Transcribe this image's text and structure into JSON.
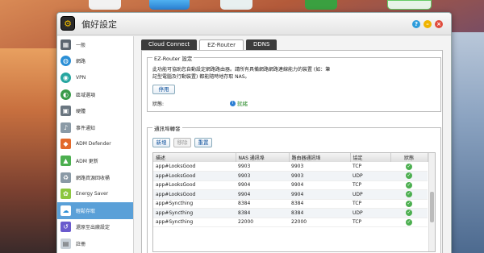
{
  "window": {
    "title": "偏好設定"
  },
  "sidebar": {
    "items": [
      {
        "label": "一般",
        "icon": "gear-grid-icon"
      },
      {
        "label": "網路",
        "icon": "globe-icon"
      },
      {
        "label": "VPN",
        "icon": "vpn-icon"
      },
      {
        "label": "區域選項",
        "icon": "region-icon"
      },
      {
        "label": "硬體",
        "icon": "hardware-icon"
      },
      {
        "label": "事件通知",
        "icon": "bell-icon"
      },
      {
        "label": "ADM Defender",
        "icon": "defender-icon"
      },
      {
        "label": "ADM 更新",
        "icon": "update-arrow-icon"
      },
      {
        "label": "網路資源回收桶",
        "icon": "recycle-icon"
      },
      {
        "label": "Energy Saver",
        "icon": "energy-icon"
      },
      {
        "label": "輕鬆存取",
        "icon": "cloud-icon"
      },
      {
        "label": "還原至出廠設定",
        "icon": "restore-icon"
      },
      {
        "label": "註冊",
        "icon": "register-icon"
      }
    ],
    "active_index": 10
  },
  "tabs": [
    {
      "label": "Cloud Connect"
    },
    {
      "label": "EZ-Router"
    },
    {
      "label": "DDNS"
    }
  ],
  "ez_router": {
    "legend": "EZ-Router 設定",
    "description": "此功能可協助您自動設定網路路由器。請所有具備網路網路連線能力的裝置 (如：筆記型電腦及行動裝置) 都能隨時地存取 NAS。",
    "disable_label": "停用",
    "status_label": "狀態:",
    "status_value": "就緒"
  },
  "port_forwarding": {
    "legend": "通訊埠轉發",
    "add_label": "新增",
    "remove_label": "移除",
    "reset_label": "重置",
    "columns": [
      "描述",
      "NAS 通訊埠",
      "路由器通訊埠",
      "協定",
      "狀態"
    ],
    "rows": [
      [
        "app#LooksGood",
        "9903",
        "9903",
        "TCP"
      ],
      [
        "app#LooksGood",
        "9903",
        "9903",
        "UDP"
      ],
      [
        "app#LooksGood",
        "9904",
        "9904",
        "TCP"
      ],
      [
        "app#LooksGood",
        "9904",
        "9904",
        "UDP"
      ],
      [
        "app#Syncthing",
        "8384",
        "8384",
        "TCP"
      ],
      [
        "app#Syncthing",
        "8384",
        "8384",
        "UDP"
      ],
      [
        "app#Syncthing",
        "22000",
        "22000",
        "TCP"
      ]
    ]
  },
  "colors": {
    "accent": "#5aa0d8",
    "ok": "#4caf50",
    "titlebar_green": "#4caf50",
    "titlebar_yellow": "#f0b400",
    "titlebar_red": "#e04b3c"
  }
}
